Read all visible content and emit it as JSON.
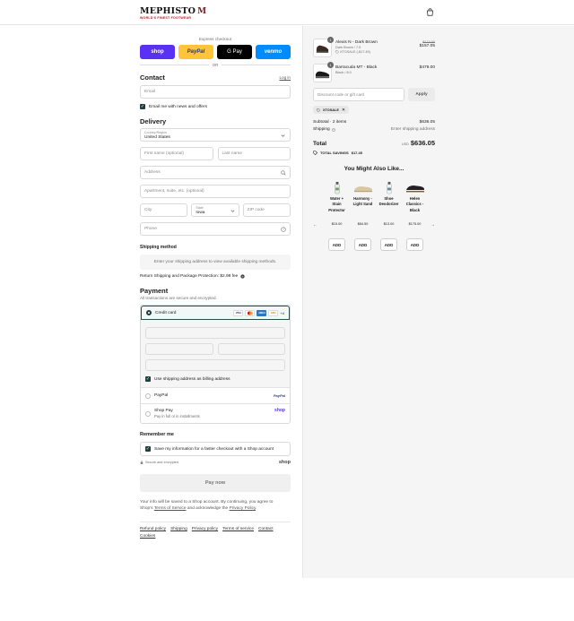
{
  "header": {
    "brand": "MEPHISTO",
    "tagline": "WORLD'S FINEST FOOTWEAR"
  },
  "express": {
    "label": "Express checkout",
    "shop": "shop",
    "paypal": "PayPal",
    "gpay": "G Pay",
    "venmo": "venmo",
    "or": "OR"
  },
  "contact": {
    "title": "Contact",
    "login": "Log in",
    "email_placeholder": "Email",
    "news_label": "Email me with news and offers"
  },
  "delivery": {
    "title": "Delivery",
    "country_label": "Country/Region",
    "country_value": "United States",
    "first_name": "First name (optional)",
    "last_name": "Last name",
    "address": "Address",
    "apartment": "Apartment, suite, etc. (optional)",
    "city": "City",
    "state_label": "State",
    "state_value": "Iowa",
    "zip": "ZIP code",
    "phone": "Phone"
  },
  "shipping": {
    "title": "Shipping method",
    "notice": "Enter your shipping address to view available shipping methods.",
    "protection": "Return Shipping and Package Protection: $2.98 fee"
  },
  "payment": {
    "title": "Payment",
    "subtitle": "All transactions are secure and encrypted.",
    "credit_card": "Credit card",
    "card_visa": "VISA",
    "card_amex": "AMEX",
    "card_discover": "DISC",
    "more_cards": "+4",
    "billing_same": "Use shipping address as billing address",
    "paypal": "PayPal",
    "paypal_logo": "PayPal",
    "shoppay": "Shop Pay",
    "shoppay_sub": "Pay in full or in installments",
    "shoppay_logo": "shop"
  },
  "remember": {
    "title": "Remember me",
    "save_label": "Save my information for a faster checkout with a Shop account",
    "secure": "Secure and encrypted",
    "shop_logo": "shop"
  },
  "pay_now": "Pay now",
  "legal": {
    "line1": "Your info will be saved to a Shop account. By continuing, you agree to",
    "line2_pre": "Shop's",
    "terms": "Terms of Service",
    "line2_mid": "and acknowledge the",
    "privacy": "Privacy Policy",
    "line2_end": "."
  },
  "footer": {
    "links": [
      "Refund policy",
      "Shipping",
      "Privacy policy",
      "Terms of service",
      "Contact",
      "Cookies"
    ]
  },
  "cart": {
    "items": [
      {
        "qty": "1",
        "name": "Alexis N - Dark Brown",
        "variant": "Dark Brown / 7.5",
        "discount": "XTOSALE (-$17.45)",
        "original_price": "$174.50",
        "price": "$157.05"
      },
      {
        "qty": "1",
        "name": "Barracuda MT - Black",
        "variant": "Black / 8.0",
        "price": "$479.00"
      }
    ],
    "discount_placeholder": "Discount code or gift card",
    "apply": "Apply",
    "code": "XTOSALE",
    "subtotal_label": "Subtotal · 2 items",
    "subtotal": "$636.05",
    "shipping_label": "Shipping",
    "shipping_value": "Enter shipping address",
    "total_label": "Total",
    "currency": "USD",
    "total": "$636.05",
    "savings_label": "TOTAL SAVINGS",
    "savings": "$17.45"
  },
  "recommend": {
    "title": "You Might Also Like...",
    "items": [
      {
        "name": "Water + Stain Protector",
        "price": "$15.00",
        "add": "ADD"
      },
      {
        "name": "Harmony - Light Sand",
        "price": "$84.50",
        "add": "ADD"
      },
      {
        "name": "Shoe Deodorizer",
        "price": "$13.00",
        "add": "ADD"
      },
      {
        "name": "Helen Classics - Black",
        "price": "$175.00",
        "add": "ADD"
      }
    ]
  }
}
